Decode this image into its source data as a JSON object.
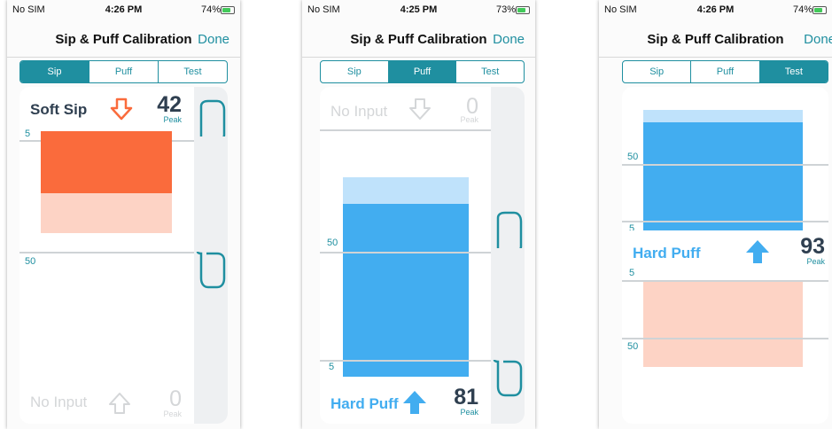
{
  "colors": {
    "accent": "#1f8fa0",
    "sip_strong": "#fa6b3c",
    "sip_light": "#fdd3c5",
    "puff_strong": "#42adf0",
    "puff_light": "#bfe2fb",
    "disabled": "#d4d6d8"
  },
  "screens": [
    {
      "status": {
        "carrier": "No SIM",
        "time": "4:26 PM",
        "battery": "74%"
      },
      "nav": {
        "title": "Sip & Puff Calibration",
        "done": "Done"
      },
      "tabs": [
        "Sip",
        "Puff",
        "Test"
      ],
      "active_tab": "Sip",
      "top_row": {
        "label": "Soft Sip",
        "value": "42",
        "unit": "Peak",
        "icon": "arrow-down-outline-icon"
      },
      "top_ticks": [
        "5",
        "50"
      ],
      "bottom_row": {
        "label": "No Input",
        "value": "0",
        "unit": "Peak",
        "icon": "arrow-up-outline-icon"
      }
    },
    {
      "status": {
        "carrier": "No SIM",
        "time": "4:25 PM",
        "battery": "73%"
      },
      "nav": {
        "title": "Sip & Puff Calibration",
        "done": "Done"
      },
      "tabs": [
        "Sip",
        "Puff",
        "Test"
      ],
      "active_tab": "Puff",
      "top_row": {
        "label": "No Input",
        "value": "0",
        "unit": "Peak",
        "icon": "arrow-down-outline-icon"
      },
      "bottom_ticks": [
        "50",
        "5"
      ],
      "bottom_row": {
        "label": "Hard Puff",
        "value": "81",
        "unit": "Peak",
        "icon": "arrow-up-solid-icon"
      }
    },
    {
      "status": {
        "carrier": "No SIM",
        "time": "4:26 PM",
        "battery": "74%"
      },
      "nav": {
        "title": "Sip & Puff Calibration",
        "done": "Done"
      },
      "tabs": [
        "Sip",
        "Puff",
        "Test"
      ],
      "active_tab": "Test",
      "ticks_upper": [
        "50",
        "5"
      ],
      "middle_row": {
        "label": "Hard Puff",
        "value": "93",
        "unit": "Peak",
        "icon": "arrow-up-solid-icon"
      },
      "ticks_lower": [
        "5",
        "50"
      ]
    }
  ]
}
